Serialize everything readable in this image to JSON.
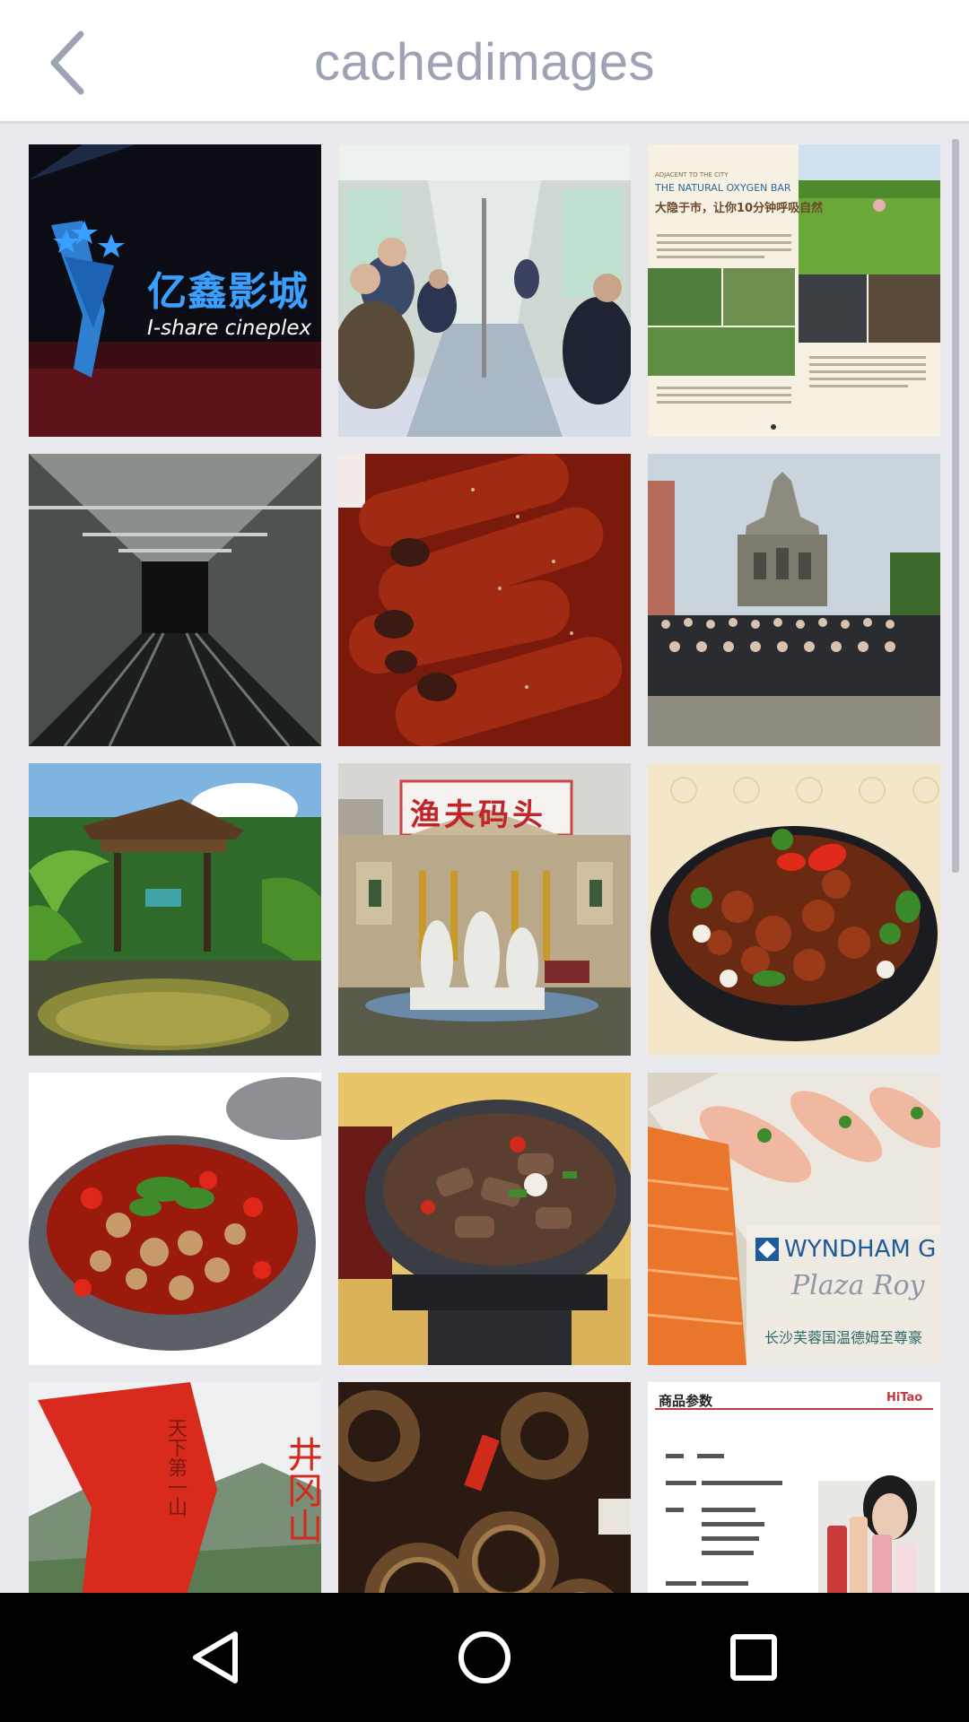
{
  "header": {
    "title": "cachedimages"
  },
  "tiles": [
    {
      "name": "cinema-logo-image",
      "text1": "亿鑫影城",
      "text2": "I-share cineplex"
    },
    {
      "name": "subway-car-image"
    },
    {
      "name": "oxygen-bar-brochure-image",
      "text1": "ADJACENT TO THE CITY",
      "text2": "THE NATURAL OXYGEN BAR",
      "text3": "大隐于市，让你10分钟呼吸自然"
    },
    {
      "name": "elevator-shaft-image"
    },
    {
      "name": "glazed-ribs-image"
    },
    {
      "name": "church-ruins-group-image"
    },
    {
      "name": "garden-pavilion-image"
    },
    {
      "name": "historic-building-statues-image",
      "text1": "渔夫码头"
    },
    {
      "name": "spicy-chicken-wok-image"
    },
    {
      "name": "chili-hotpot-image"
    },
    {
      "name": "braised-beef-wok-image"
    },
    {
      "name": "sashimi-wyndham-image",
      "text1": "WYNDHAM G",
      "text2": "Plaza Roy",
      "text3": "长沙芙蓉国温德姆至尊豪"
    },
    {
      "name": "jinggangshan-monument-image",
      "text1": "井冈山",
      "text2": "天下第一山"
    },
    {
      "name": "braised-eel-image"
    },
    {
      "name": "product-spec-sheet-image",
      "text1": "商品参数",
      "text2": "HiTao"
    }
  ],
  "colors": {
    "appbar": "#ffffff",
    "title": "#9ea2b5",
    "background": "#e9e9ee",
    "navbar": "#000000"
  },
  "nav": {
    "back": "back-icon",
    "home": "home-icon",
    "recents": "recents-icon"
  }
}
